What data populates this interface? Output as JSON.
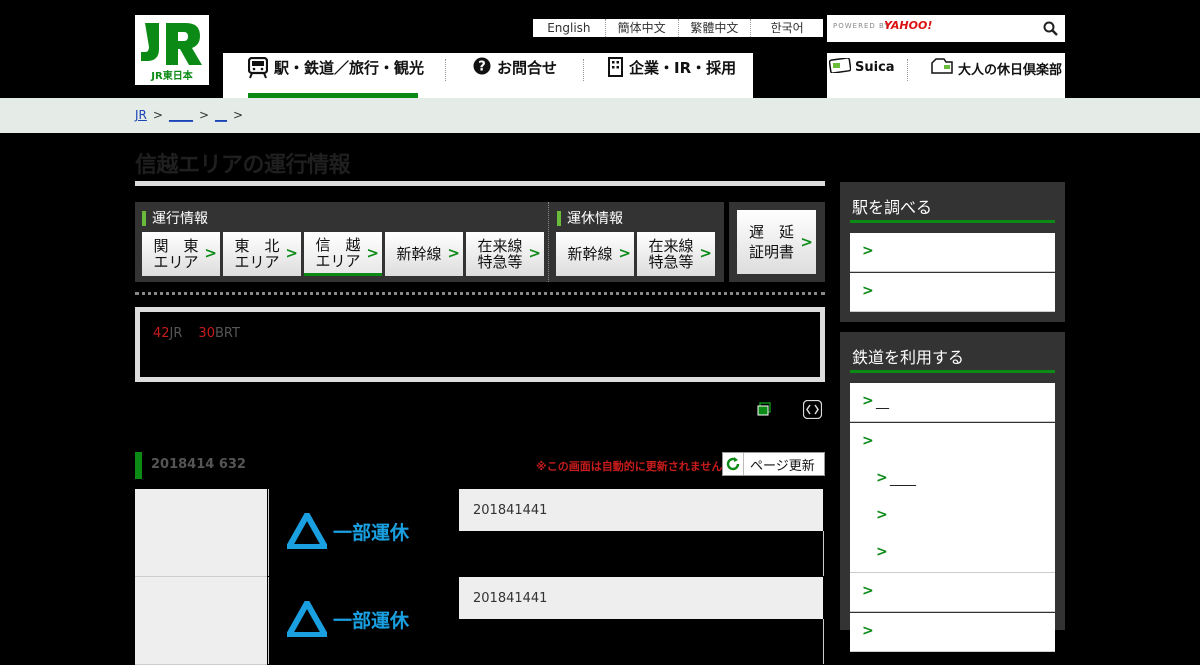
{
  "header": {
    "logo_text": "JR東日本",
    "languages": [
      "English",
      "簡体中文",
      "繁體中文",
      "한국어"
    ],
    "search": {
      "powered_by": "POWERED BY",
      "provider": "YAHOO!"
    },
    "gnav": [
      "駅・鉄道／旅行・観光",
      "お問合せ",
      "企業・IR・採用"
    ],
    "services": [
      "Suica",
      "大人の休日倶楽部"
    ]
  },
  "breadcrumb": {
    "home": "JR",
    "level2": "____",
    "level3": "__",
    "sep": ">"
  },
  "page": {
    "title": "信越エリアの運行情報",
    "tabs": {
      "group1_heading": "運行情報",
      "group1": [
        {
          "line1": "関　東",
          "line2": "エリア"
        },
        {
          "line1": "東　北",
          "line2": "エリア"
        },
        {
          "line1": "信　越",
          "line2": "エリア"
        },
        {
          "line1": "新幹線",
          "line2": ""
        },
        {
          "line1": "在来線",
          "line2": "特急等"
        }
      ],
      "group2_heading": "運休情報",
      "group2": [
        {
          "line1": "新幹線",
          "line2": ""
        },
        {
          "line1": "在来線",
          "line2": "特急等"
        }
      ],
      "delay": {
        "line1": "遅　延",
        "line2": "証明書"
      }
    },
    "notice": {
      "num1": "42",
      "text1": "JR",
      "num2": "30",
      "text2": "BRT"
    },
    "update": {
      "datetime": "2018414 632",
      "warning": "※この画面は自動的に更新されません",
      "refresh_label": "ページ更新"
    },
    "rows": [
      {
        "status": "一部運休",
        "date": "201841441"
      },
      {
        "status": "一部運休",
        "date": "201841441"
      }
    ]
  },
  "sidebar": {
    "station": {
      "title": "駅を調べる",
      "items": [
        "",
        ""
      ]
    },
    "rail": {
      "title": "鉄道を利用する",
      "items": [
        "__",
        "",
        "____",
        "",
        "",
        "",
        ""
      ]
    }
  },
  "colors": {
    "brand_green": "#0b8a16",
    "alert_red": "#c91c1c",
    "status_blue": "#1aa0e0"
  }
}
